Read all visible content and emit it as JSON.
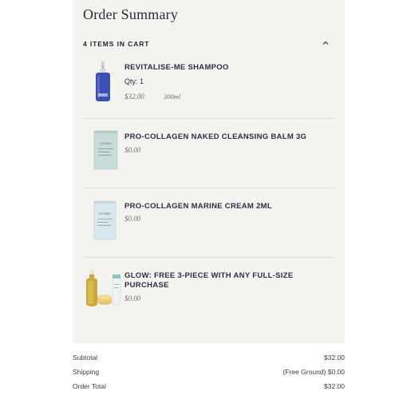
{
  "summary": {
    "title": "Order Summary",
    "cart_count": "4 ITEMS IN CART"
  },
  "items": [
    {
      "name": "REVITALISE-ME SHAMPOO",
      "qty": "Qty: 1",
      "price": "$32.00",
      "size": "300ml"
    },
    {
      "name": "PRO-COLLAGEN NAKED CLEANSING BALM 3G",
      "price": "$0.00",
      "brand": "ELEMIS"
    },
    {
      "name": "PRO-COLLAGEN MARINE CREAM 2ML",
      "price": "$0.00",
      "brand": "ELEMIS"
    },
    {
      "name_line1": "GLOW: FREE 3-PIECE WITH ANY FULL-SIZE",
      "name_line2": "PURCHASE",
      "price": "$0.00"
    }
  ],
  "totals": {
    "subtotal_label": "Subtotal",
    "subtotal_value": "$32.00",
    "shipping_label": "Shipping",
    "shipping_value": "(Free Ground) $0.00",
    "total_label": "Order Total",
    "total_value": "$32.00"
  },
  "colors": {
    "panel_bg": "#f5f3f0",
    "text_primary": "#2a2f48",
    "text_muted": "#6b6e74",
    "shampoo_bottle": "#3d4fb3"
  },
  "icons": {
    "collapse": "chevron-up-icon"
  }
}
